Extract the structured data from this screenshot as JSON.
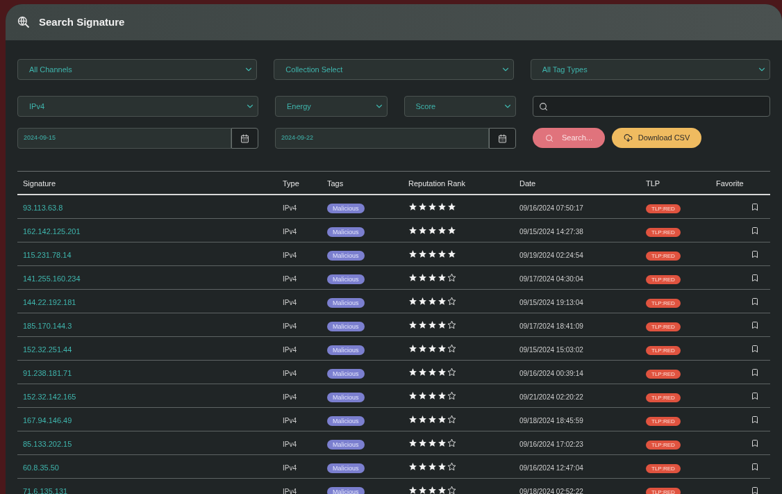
{
  "window": {
    "title": "Search Signature"
  },
  "filters": {
    "row_1": [
      {
        "value": "All Channels"
      },
      {
        "value": "Collection Select"
      },
      {
        "value": "All Tag Types"
      }
    ],
    "row_2": [
      {
        "value": "IPv4"
      },
      {
        "value": "Energy"
      },
      {
        "value": "Score"
      }
    ],
    "dates": [
      {
        "value": "2024-09-15"
      },
      {
        "value": "2024-09-22"
      }
    ],
    "search_button": "Search...",
    "download_button": "Download CSV"
  },
  "table": {
    "columns": [
      "Signature",
      "Type",
      "Tags",
      "Reputation Rank",
      "Date",
      "TLP",
      "Favorite"
    ],
    "rows": [
      {
        "signature": "93.113.63.8",
        "type": "IPv4",
        "tag": "Malicious",
        "stars": 5,
        "date": "09/16/2024 07:50:17",
        "tlp": "TLP:RED"
      },
      {
        "signature": "162.142.125.201",
        "type": "IPv4",
        "tag": "Malicious",
        "stars": 5,
        "date": "09/15/2024 14:27:38",
        "tlp": "TLP:RED"
      },
      {
        "signature": "115.231.78.14",
        "type": "IPv4",
        "tag": "Malicious",
        "stars": 5,
        "date": "09/19/2024 02:24:54",
        "tlp": "TLP:RED"
      },
      {
        "signature": "141.255.160.234",
        "type": "IPv4",
        "tag": "Malicious",
        "stars": 4,
        "date": "09/17/2024 04:30:04",
        "tlp": "TLP:RED"
      },
      {
        "signature": "144.22.192.181",
        "type": "IPv4",
        "tag": "Malicious",
        "stars": 4,
        "date": "09/15/2024 19:13:04",
        "tlp": "TLP:RED"
      },
      {
        "signature": "185.170.144.3",
        "type": "IPv4",
        "tag": "Malicious",
        "stars": 4,
        "date": "09/17/2024 18:41:09",
        "tlp": "TLP:RED"
      },
      {
        "signature": "152.32.251.44",
        "type": "IPv4",
        "tag": "Malicious",
        "stars": 4,
        "date": "09/15/2024 15:03:02",
        "tlp": "TLP:RED"
      },
      {
        "signature": "91.238.181.71",
        "type": "IPv4",
        "tag": "Malicious",
        "stars": 4,
        "date": "09/16/2024 00:39:14",
        "tlp": "TLP:RED"
      },
      {
        "signature": "152.32.142.165",
        "type": "IPv4",
        "tag": "Malicious",
        "stars": 4,
        "date": "09/21/2024 02:20:22",
        "tlp": "TLP:RED"
      },
      {
        "signature": "167.94.146.49",
        "type": "IPv4",
        "tag": "Malicious",
        "stars": 4,
        "date": "09/18/2024 18:45:59",
        "tlp": "TLP:RED"
      },
      {
        "signature": "85.133.202.15",
        "type": "IPv4",
        "tag": "Malicious",
        "stars": 4,
        "date": "09/16/2024 17:02:23",
        "tlp": "TLP:RED"
      },
      {
        "signature": "60.8.35.50",
        "type": "IPv4",
        "tag": "Malicious",
        "stars": 4,
        "date": "09/16/2024 12:47:04",
        "tlp": "TLP:RED"
      },
      {
        "signature": "71.6.135.131",
        "type": "IPv4",
        "tag": "Malicious",
        "stars": 4,
        "date": "09/18/2024 02:52:22",
        "tlp": "TLP:RED"
      }
    ]
  }
}
